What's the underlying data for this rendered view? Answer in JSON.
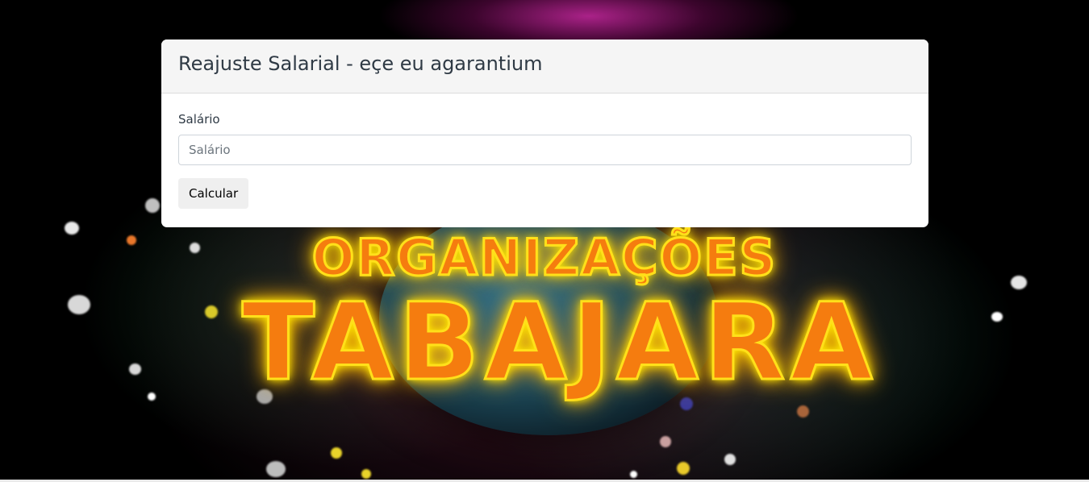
{
  "card": {
    "title": "Reajuste Salarial - eçe eu agarantium"
  },
  "form": {
    "salary_label": "Salário",
    "salary_placeholder": "Salário",
    "salary_value": "",
    "submit_label": "Calcular"
  },
  "background": {
    "logo_line1": "ORGANIZAÇÕES",
    "logo_line2": "TABAJARA"
  },
  "colors": {
    "logo_fill": "#f57c0f",
    "logo_glow": "#ffe01a",
    "card_header_bg": "#f5f5f5",
    "button_bg": "#efefef"
  }
}
